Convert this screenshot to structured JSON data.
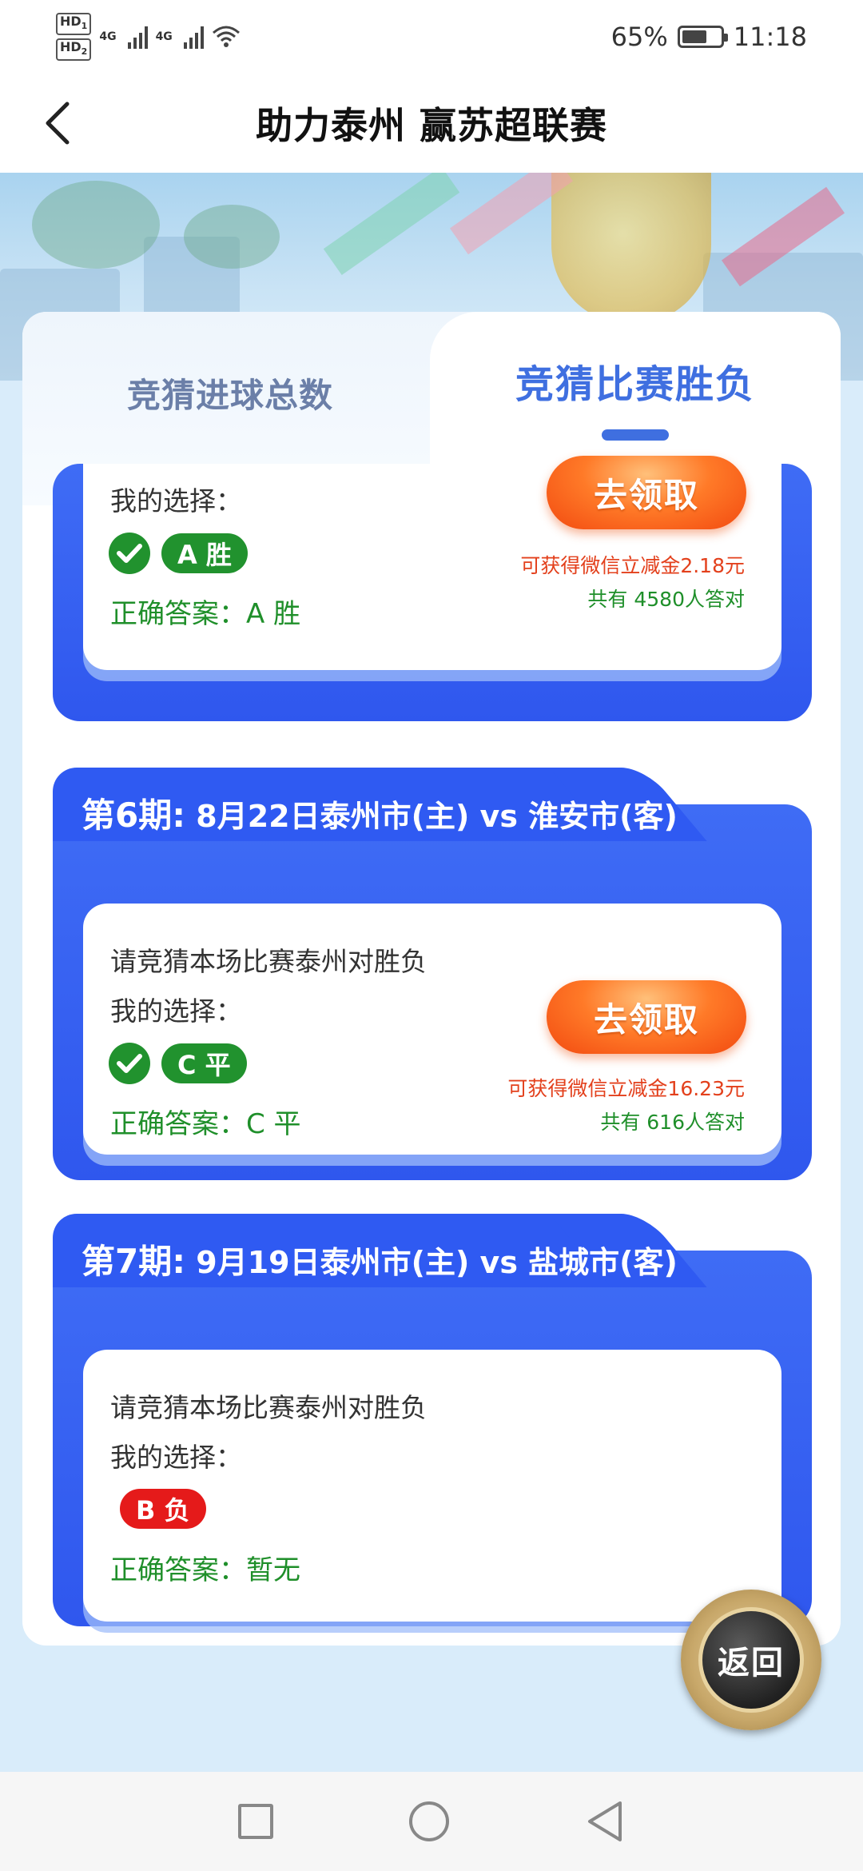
{
  "status_bar": {
    "hd1": "HD",
    "hd2": "HD",
    "sim1": "1",
    "sim2": "2",
    "net1": "4G",
    "net2": "4G",
    "battery_percent": "65%",
    "battery_level": 0.65,
    "time": "11:18"
  },
  "header": {
    "back_icon": "chevron-left-icon",
    "title": "助力泰州 赢苏超联赛"
  },
  "tabs": {
    "items": [
      {
        "label": "竞猜进球总数",
        "active": false
      },
      {
        "label": "竞猜比赛胜负",
        "active": true
      }
    ]
  },
  "periods": [
    {
      "question": "",
      "my_choice_label": "我的选择：",
      "choice_badge": "A 胜",
      "choice_correct": true,
      "answer": "正确答案：A 胜",
      "claim_label": "去领取",
      "reward": "可获得微信立减金2.18元",
      "count": "共有 4580人答对"
    },
    {
      "title_period": "第6期:",
      "title_match": " 8月22日泰州市(主) vs 淮安市(客)",
      "question": "请竞猜本场比赛泰州对胜负",
      "my_choice_label": "我的选择：",
      "choice_badge": "C 平",
      "choice_correct": true,
      "answer": "正确答案：C 平",
      "claim_label": "去领取",
      "reward": "可获得微信立减金16.23元",
      "count": "共有 616人答对"
    },
    {
      "title_period": "第7期:",
      "title_match": " 9月19日泰州市(主) vs 盐城市(客)",
      "question": "请竞猜本场比赛泰州对胜负",
      "my_choice_label": "我的选择：",
      "choice_badge": "B 负",
      "choice_correct": false,
      "answer": "正确答案：暂无"
    }
  ],
  "return_button": {
    "label": "返回"
  },
  "nav_bar": {
    "items": [
      "recent-apps-icon",
      "home-icon",
      "back-icon"
    ]
  },
  "colors": {
    "accent_blue": "#3f6fe0",
    "card_blue": "#2f57ee",
    "correct_green": "#21922e",
    "wrong_red": "#e51a1a",
    "reward_orange": "#e3401c"
  }
}
